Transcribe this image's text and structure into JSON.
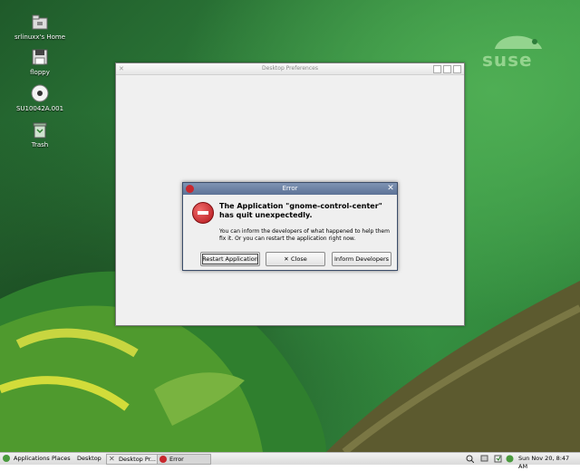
{
  "desktop": {
    "icons": [
      {
        "label": "srlinuxx's Home"
      },
      {
        "label": "floppy"
      },
      {
        "label": "SU10042A.001"
      },
      {
        "label": "Trash"
      }
    ],
    "logo_text": "suse"
  },
  "window": {
    "title": "Desktop Preferences"
  },
  "dialog": {
    "title": "Error",
    "headline": "The Application \"gnome-control-center\" has quit unexpectedly.",
    "message": "You can inform the developers of what happened to help them fix it.  Or you can restart the application right now.",
    "buttons": {
      "restart": "Restart Application",
      "close": "Close",
      "inform": "Inform Developers"
    }
  },
  "panel": {
    "menus": [
      "Applications",
      "Places",
      "Desktop"
    ],
    "tasks": [
      {
        "label": "Desktop Pr..."
      },
      {
        "label": "Error"
      }
    ],
    "clock": "Sun Nov 20,  8:47 AM"
  },
  "colors": {
    "dialog_titlebar": "#6a80a4",
    "error_red": "#c8282e",
    "suse_green": "#94d48e"
  }
}
